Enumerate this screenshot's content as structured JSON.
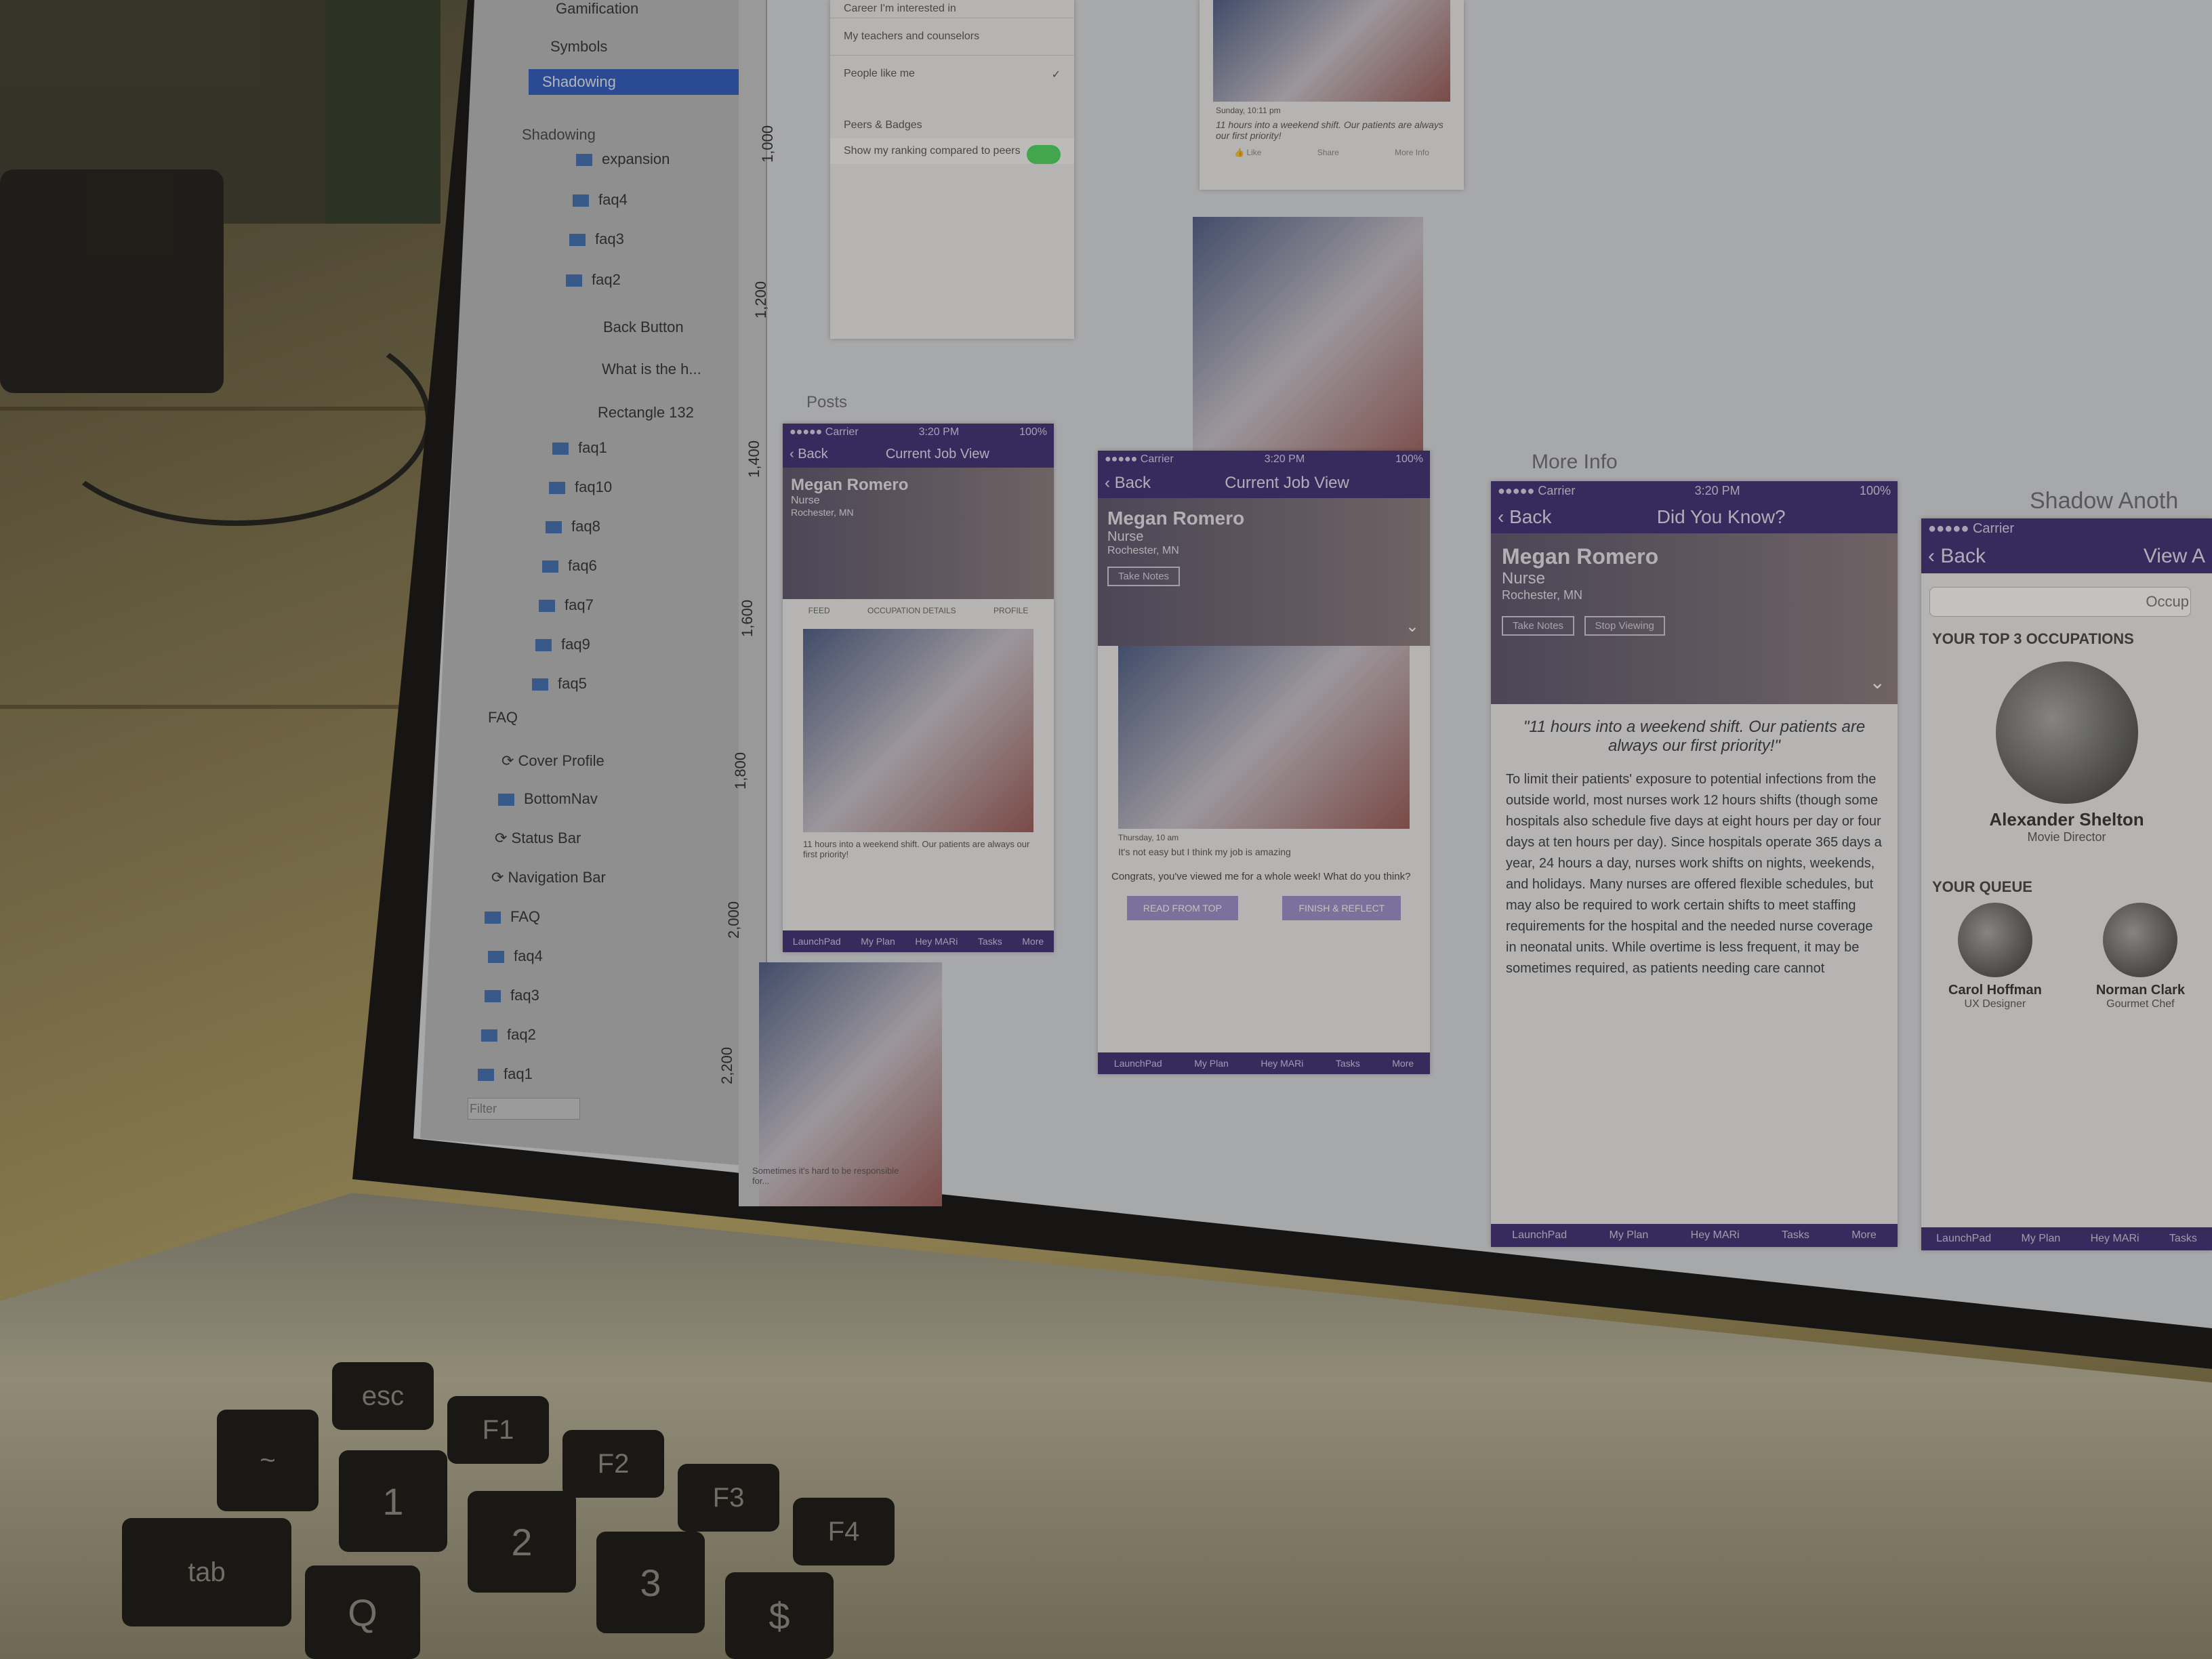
{
  "sidebar": {
    "items": [
      {
        "label": "Gamification"
      },
      {
        "label": "Symbols"
      },
      {
        "label": "Shadowing"
      }
    ],
    "layers_header": "Shadowing",
    "layers": [
      {
        "label": "expansion"
      },
      {
        "label": "faq4"
      },
      {
        "label": "faq3"
      },
      {
        "label": "faq2"
      },
      {
        "label": "Back Button"
      },
      {
        "label": "What is the h..."
      },
      {
        "label": "Rectangle 132"
      },
      {
        "label": "faq1"
      },
      {
        "label": "faq10"
      },
      {
        "label": "faq8"
      },
      {
        "label": "faq6"
      },
      {
        "label": "faq7"
      },
      {
        "label": "faq9"
      },
      {
        "label": "faq5"
      },
      {
        "label": "FAQ"
      },
      {
        "label": "Cover Profile"
      },
      {
        "label": "BottomNav"
      },
      {
        "label": "Status Bar"
      },
      {
        "label": "Navigation Bar"
      },
      {
        "label": "FAQ"
      },
      {
        "label": "faq4"
      },
      {
        "label": "faq3"
      },
      {
        "label": "faq2"
      },
      {
        "label": "faq1"
      }
    ],
    "filter_placeholder": "Filter"
  },
  "ruler": {
    "ticks": [
      "1,000",
      "1,200",
      "1,400",
      "1,600",
      "1,800",
      "2,000",
      "2,200"
    ]
  },
  "settings_artboard": {
    "rows": [
      "Career I'm interested in",
      "My teachers and counselors",
      "People like me"
    ],
    "section": "Peers & Badges",
    "toggle_label": "Show my ranking compared to peers"
  },
  "canvas_labels": {
    "posts": "Posts",
    "more_info": "More Info",
    "shadow_another": "Shadow Anoth"
  },
  "job_view": {
    "carrier": "●●●●● Carrier",
    "time": "3:20 PM",
    "battery": "100%",
    "back": "Back",
    "title": "Current Job View",
    "name": "Megan Romero",
    "role": "Nurse",
    "location": "Rochester, MN",
    "btn_take_notes": "Take Notes",
    "btn_stop_viewing": "Stop Viewing",
    "tabs": [
      "FEED",
      "OCCUPATION DETAILS",
      "PROFILE"
    ]
  },
  "feed": {
    "post_time": "Sunday, 10:11 pm",
    "post_caption": "11 hours into a weekend shift. Our patients are always our first priority!",
    "like": "Like",
    "share": "Share",
    "more_info": "More Info",
    "post2_time": "Thursday, 10 am",
    "post2_caption": "It's not easy but I think my job is amazing",
    "post3_caption": "Sometimes it's hard to be responsible for..."
  },
  "congrats": {
    "text": "Congrats, you've viewed me for a whole week! What do you think?",
    "btn_read": "READ FROM TOP",
    "btn_finish": "FINISH & REFLECT"
  },
  "tabbar": [
    "LaunchPad",
    "My Plan",
    "Hey MARi",
    "Tasks",
    "More"
  ],
  "did_you_know": {
    "title": "Did You Know?",
    "quote": "\"11 hours into a weekend shift. Our patients are always our first priority!\"",
    "body": "To limit their patients' exposure to potential infections from the outside world, most nurses work 12 hours shifts (though some hospitals also schedule five days at eight hours per day or four days at ten hours per day). Since hospitals operate 365 days a year, 24 hours a day, nurses work shifts on nights, weekends, and holidays. Many nurses are offered flexible schedules, but may also be required to work certain shifts to meet staffing requirements for the hospital and the needed nurse coverage in neonatal units. While overtime is less frequent, it may be sometimes required, as patients needing care cannot"
  },
  "shadow_another": {
    "back": "Back",
    "title": "View A",
    "search_placeholder": "Occup",
    "top3_header": "YOUR TOP 3 OCCUPATIONS",
    "top_person": {
      "name": "Alexander Shelton",
      "role": "Movie Director"
    },
    "queue_header": "YOUR QUEUE",
    "queue": [
      {
        "name": "Carol Hoffman",
        "role": "UX Designer"
      },
      {
        "name": "Norman Clark",
        "role": "Gourmet Chef"
      }
    ]
  },
  "keyboard": {
    "keys": [
      {
        "label": "esc"
      },
      {
        "label": "F1"
      },
      {
        "label": "F2"
      },
      {
        "label": "F3"
      },
      {
        "label": "F4"
      },
      {
        "label": "~"
      },
      {
        "label": "!"
      },
      {
        "label": "@"
      },
      {
        "label": "#"
      },
      {
        "label": "$"
      },
      {
        "label": "1"
      },
      {
        "label": "2"
      },
      {
        "label": "3"
      },
      {
        "label": "tab"
      },
      {
        "label": "Q"
      }
    ]
  },
  "colors": {
    "brand": "#3c2f78",
    "selection": "#2c5bc4",
    "toggle_on": "#4cd964"
  }
}
